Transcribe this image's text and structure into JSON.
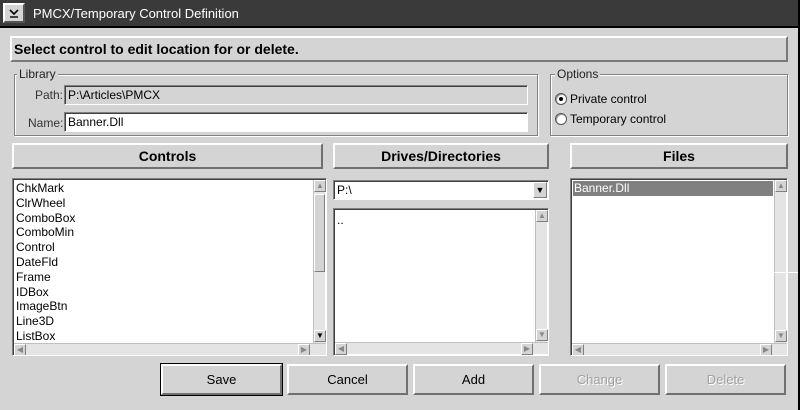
{
  "window": {
    "title": "PMCX/Temporary Control Definition",
    "sysmenu_icon": "chevron-down-icon"
  },
  "instruction": "Select control to edit location for or delete.",
  "library": {
    "legend": "Library",
    "path_label": "Path:",
    "path_value": "P:\\Articles\\PMCX",
    "name_label": "Name:",
    "name_value": "Banner.Dll"
  },
  "options": {
    "legend": "Options",
    "items": [
      {
        "label": "Private control",
        "selected": true
      },
      {
        "label": "Temporary control",
        "selected": false
      }
    ]
  },
  "headers": {
    "controls": "Controls",
    "drives": "Drives/Directories",
    "files": "Files"
  },
  "controls_list": {
    "items": [
      "ChkMark",
      "ClrWheel",
      "ComboBox",
      "ComboMin",
      "Control",
      "DateFld",
      "Frame",
      "IDBox",
      "ImageBtn",
      "Line3D",
      "ListBox"
    ]
  },
  "drive_combo": {
    "value": "P:\\"
  },
  "directory_list": {
    "items": [
      ".."
    ]
  },
  "files_list": {
    "items": [
      "Banner.Dll"
    ],
    "selected": "Banner.Dll"
  },
  "buttons": {
    "save": "Save",
    "cancel": "Cancel",
    "add": "Add",
    "change": "Change",
    "delete": "Delete"
  },
  "colors": {
    "face": "#d4d4d4",
    "titlebar": "#3a3a3a",
    "selection": "#808080"
  }
}
